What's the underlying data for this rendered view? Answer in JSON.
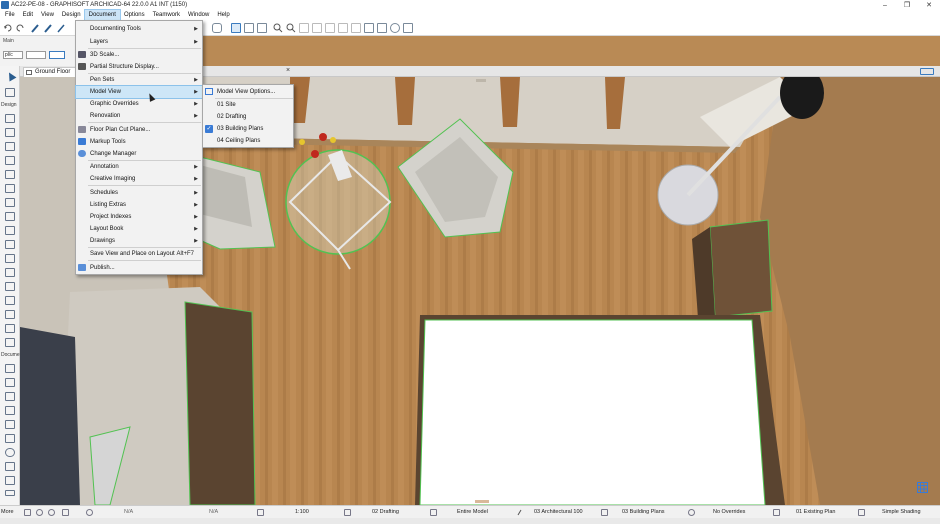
{
  "window": {
    "title": "AC22-PE-08 - GRAPHISOFT ARCHICAD-64 22.0.0 A1 INT (1150)",
    "controls": [
      "–",
      "❐",
      "✕"
    ]
  },
  "menubar": {
    "items": [
      "File",
      "Edit",
      "View",
      "Design",
      "Document",
      "Options",
      "Teamwork",
      "Window",
      "Help"
    ],
    "active": "Document"
  },
  "infobox": {
    "main_label": "Main",
    "field_1": "pl/c",
    "field_2": ""
  },
  "tab": {
    "label": "Ground Floor",
    "close": "×"
  },
  "toolbox": {
    "design_label": "Design",
    "document_label": "Docume",
    "more_label": "More"
  },
  "document_menu": {
    "items": [
      {
        "label": "Documenting Tools",
        "submenu": true
      },
      {
        "label": "Layers",
        "submenu": true
      },
      {
        "label": "3D Scale...",
        "submenu": false
      },
      {
        "label": "Partial Structure Display...",
        "submenu": false
      },
      {
        "label": "Pen Sets",
        "submenu": true
      },
      {
        "label": "Model View",
        "submenu": true
      },
      {
        "label": "Graphic Overrides",
        "submenu": true
      },
      {
        "label": "Renovation",
        "submenu": true
      },
      {
        "label": "Floor Plan Cut Plane...",
        "submenu": false
      },
      {
        "label": "Markup Tools",
        "submenu": false
      },
      {
        "label": "Change Manager",
        "submenu": false
      },
      {
        "label": "Annotation",
        "submenu": true
      },
      {
        "label": "Creative Imaging",
        "submenu": true
      },
      {
        "label": "Schedules",
        "submenu": true
      },
      {
        "label": "Listing Extras",
        "submenu": true
      },
      {
        "label": "Project Indexes",
        "submenu": true
      },
      {
        "label": "Layout Book",
        "submenu": true
      },
      {
        "label": "Drawings",
        "submenu": true
      },
      {
        "label": "Save View and Place on Layout",
        "shortcut": "Alt+F7"
      },
      {
        "label": "Publish...",
        "submenu": false
      }
    ]
  },
  "model_view_submenu": {
    "items": [
      {
        "label": "Model View Options...",
        "checked": false
      },
      {
        "label": "01 Site",
        "checked": false
      },
      {
        "label": "02 Drafting",
        "checked": false
      },
      {
        "label": "03 Building Plans",
        "checked": true
      },
      {
        "label": "04 Ceiling Plans",
        "checked": false
      }
    ]
  },
  "statusbar": {
    "na_1": "N/A",
    "na_2": "N/A",
    "scale": "1:100",
    "layer_combo": "02 Drafting",
    "structure": "Entire Model",
    "pen_set": "03 Architectural 100",
    "model_view": "03 Building Plans",
    "overrides": "No Overrides",
    "renovation": "01 Existing Plan",
    "shading": "Simple Shading"
  },
  "colors": {
    "menu_highlight": "#cde6f7",
    "floor": "#b98a55",
    "selection": "#52c252",
    "check": "#3a7bd5"
  }
}
